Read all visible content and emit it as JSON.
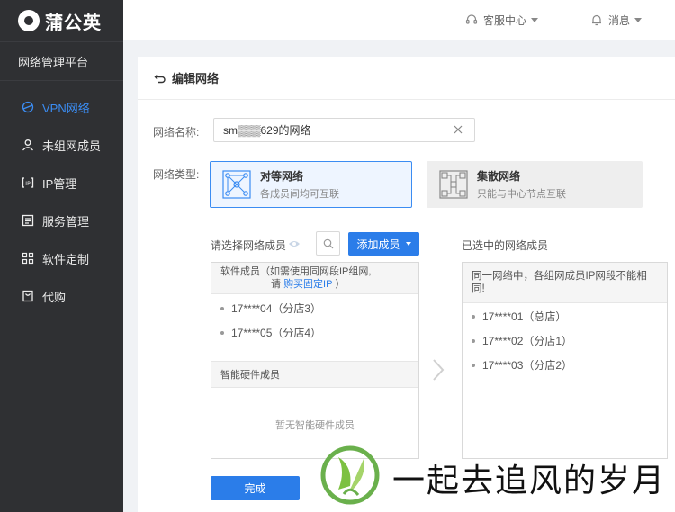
{
  "brand": {
    "name": "蒲公英",
    "platform": "网络管理平台"
  },
  "sidebar": {
    "items": [
      {
        "label": "VPN网络",
        "icon": "vpn-icon",
        "active": true
      },
      {
        "label": "未组网成员",
        "icon": "user-icon",
        "active": false
      },
      {
        "label": "IP管理",
        "icon": "ip-icon",
        "active": false
      },
      {
        "label": "服务管理",
        "icon": "service-icon",
        "active": false
      },
      {
        "label": "软件定制",
        "icon": "grid-icon",
        "active": false
      },
      {
        "label": "代购",
        "icon": "cart-icon",
        "active": false
      }
    ]
  },
  "topbar": {
    "support": "客服中心",
    "messages": "消息"
  },
  "page": {
    "title": "编辑网络"
  },
  "form": {
    "name_label": "网络名称:",
    "name_value": "sm▒▒▒629的网络",
    "type_label": "网络类型:",
    "types": [
      {
        "title": "对等网络",
        "desc": "各成员间均可互联",
        "selected": true
      },
      {
        "title": "集散网络",
        "desc": "只能与中心节点互联",
        "selected": false
      }
    ]
  },
  "members": {
    "select_label": "请选择网络成员",
    "add_button": "添加成员",
    "selected_label": "已选中的网络成员",
    "software_head_line1": "软件成员（如需使用同网段IP组网,",
    "software_head_prefix": "请 ",
    "software_head_link": "购买固定IP",
    "software_head_suffix": " ）",
    "available": [
      "17****04（分店3）",
      "17****05（分店4）"
    ],
    "hardware_head": "智能硬件成员",
    "hardware_empty": "暂无智能硬件成员",
    "selected_note": "同一网络中，各组网成员IP网段不能相同!",
    "selected": [
      "17****01（总店）",
      "17****02（分店1）",
      "17****03（分店2）"
    ]
  },
  "actions": {
    "done": "完成"
  },
  "watermark": {
    "text": "一起去追风的岁月"
  },
  "colors": {
    "accent": "#2b7de9",
    "sidebar_bg": "#2f3033",
    "active_nav": "#3b8cf2"
  }
}
